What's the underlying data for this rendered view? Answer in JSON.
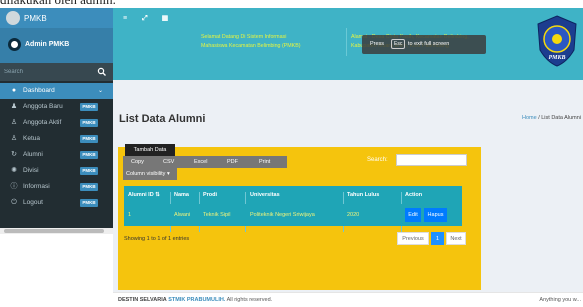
{
  "top_text": "dilakukan oleh admin.",
  "sidebar": {
    "brand": "PMKB",
    "user": "Admin PMKB",
    "search_placeholder": "Search",
    "menu": [
      {
        "label": "Dashboard",
        "badge": ""
      },
      {
        "label": "Anggota Baru",
        "badge": "PMKB"
      },
      {
        "label": "Anggota Aktif",
        "badge": "PMKB"
      },
      {
        "label": "Ketua",
        "badge": "PMKB"
      },
      {
        "label": "Alumni",
        "badge": "PMKB"
      },
      {
        "label": "Divisi",
        "badge": "PMKB"
      },
      {
        "label": "Informasi",
        "badge": "PMKB"
      },
      {
        "label": "Logout",
        "badge": "PMKB"
      }
    ]
  },
  "topbar": {
    "left_line1": "Selamat Datang Di Sistem Informasi",
    "left_line2": "Mahasiswa Kecamatan Belimbing (PMKB)",
    "right_line1": "Alamat : Desa Cinta Kasih, Kecamatan Belimbing,",
    "right_line2": "Kabupaten Muara Enim, Kota Palembang",
    "logo_text": "PMKB",
    "fullscreen": {
      "press": "Press",
      "key": "Esc",
      "rest": "to exit full screen"
    }
  },
  "page": {
    "title": "List Data Alumni",
    "breadcrumb_home": "Home",
    "breadcrumb_sep": "/",
    "breadcrumb_current": "List Data Alumni"
  },
  "toolbar": {
    "add_button": "Tambah Data",
    "exports": [
      "Copy",
      "CSV",
      "Excel",
      "PDF",
      "Print"
    ],
    "column_visibility": "Column visibility",
    "search_label": "Search:"
  },
  "table": {
    "headers": [
      "Alumni ID",
      "Nama",
      "Prodi",
      "Universitas",
      "Tahun Lulus",
      "Action"
    ],
    "rows": [
      {
        "alumni_id": "1",
        "nama": "Alwani",
        "prodi": "Teknik Sipil",
        "universitas": "Politeknik Negeri Sriwijaya",
        "tahun_lulus": "2020",
        "edit": "Edit",
        "hapus": "Hapus"
      }
    ],
    "info": "Showing 1 to 1 of 1 entries",
    "pager": {
      "previous": "Previous",
      "current": "1",
      "next": "Next"
    }
  },
  "footer": {
    "author": "DESTIN SELVARIA",
    "brand": "STMIK PRABUMULIH.",
    "rights": "All rights reserved.",
    "right_text": "Anything you w..."
  },
  "colors": {
    "topbar": "#3fb3c6",
    "sidebar": "#222d32",
    "active": "#3c8dbc",
    "box": "#f5c40d",
    "table": "#1fa5b6",
    "button": "#007bff"
  }
}
